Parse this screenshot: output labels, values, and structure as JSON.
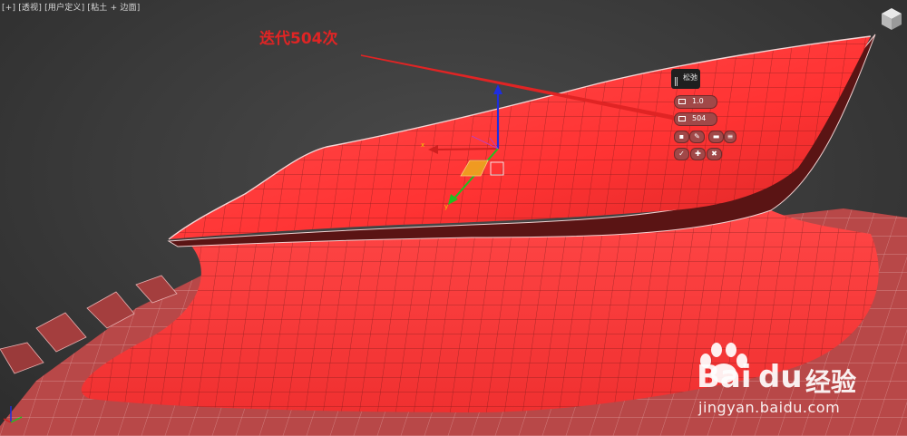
{
  "viewport": {
    "label": "[+] [透视] [用户定义] [粘土 + 边面]"
  },
  "annotation": {
    "text": "迭代504次",
    "color": "#e02424"
  },
  "relax_panel": {
    "title": "松弛",
    "amount_value": "1.0",
    "iterations_value": "504",
    "buttons": [
      "apply-icon",
      "brush-icon",
      "keep-boundary-icon",
      "saturate-icon",
      "settings-icon",
      "pin-icon",
      "cancel-icon"
    ]
  },
  "colors": {
    "surface": "#ff4040",
    "surface_dark": "#b02222",
    "annotation": "#e02424",
    "panel_field": "#a14848",
    "gizmo_x": "#d02020",
    "gizmo_y": "#20c020",
    "gizmo_z": "#1e2ee0"
  },
  "watermark": {
    "brand": "Bai",
    "brand2": "du",
    "product": "经验",
    "url": "jingyan.baidu.com"
  }
}
